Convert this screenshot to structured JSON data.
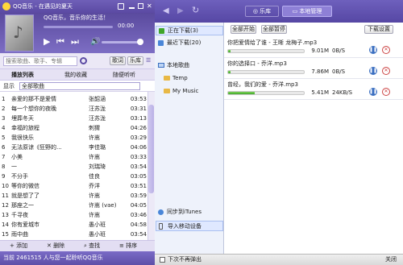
{
  "app": {
    "title": "QQ音乐 - 在遇见的夏天",
    "now_playing": "QQ音乐，音乐你的生活！",
    "time": "00:00",
    "search_placeholder": "搜索歌曲、歌手、专辑",
    "search_btn": "搜索",
    "lyrics_btn": "歌词",
    "library_btn": "乐库"
  },
  "playlist_tabs": [
    "播放列表",
    "我的收藏",
    "随便听听"
  ],
  "list_header": {
    "label": "显示",
    "value": "全部歌曲"
  },
  "songs": [
    {
      "n": "1",
      "title": "亲爱的那不是爱情",
      "artist": "张韶涵",
      "time": "03:53"
    },
    {
      "n": "2",
      "title": "每一个想你的夜晚",
      "artist": "汪苏泷",
      "time": "03:31"
    },
    {
      "n": "3",
      "title": "埋葬冬天",
      "artist": "汪苏泷",
      "time": "03:13"
    },
    {
      "n": "4",
      "title": "幸福的旅程",
      "artist": "刺猬",
      "time": "04:26"
    },
    {
      "n": "5",
      "title": "我很快乐",
      "artist": "许嵩",
      "time": "03:29"
    },
    {
      "n": "6",
      "title": "无法原谅《狂野的...",
      "artist": "李佳璐",
      "time": "04:06"
    },
    {
      "n": "7",
      "title": "小美",
      "artist": "许嵩",
      "time": "03:33"
    },
    {
      "n": "8",
      "title": "一",
      "artist": "刘瑞琦",
      "time": "03:54"
    },
    {
      "n": "9",
      "title": "不分手",
      "artist": "佳良",
      "time": "03:05"
    },
    {
      "n": "10",
      "title": "等你的微信",
      "artist": "乔洋",
      "time": "03:51"
    },
    {
      "n": "11",
      "title": "就是想了了",
      "artist": "许嵩",
      "time": "03:59"
    },
    {
      "n": "12",
      "title": "那座之一",
      "artist": "许嵩 (vae)",
      "time": "04:05"
    },
    {
      "n": "13",
      "title": "千寻夜",
      "artist": "许嵩",
      "time": "03:46"
    },
    {
      "n": "14",
      "title": "你有爱城市",
      "artist": "愚小班",
      "time": "04:58"
    },
    {
      "n": "15",
      "title": "雨中曲",
      "artist": "愚小班",
      "time": "03:54"
    }
  ],
  "bottom_actions": [
    "添加",
    "删除",
    "查找",
    "排序"
  ],
  "status_text": "当前 2461515 人与您一起聆听QQ音乐",
  "nav_tabs": [
    "乐库",
    "本地管理"
  ],
  "tree": {
    "downloading": "正在下载(3)",
    "recent": "最近下载(20)",
    "local": "本地歌曲",
    "folders": [
      "Temp",
      "My Music"
    ],
    "sync": "同步到iTunes",
    "import": "导入移动设备"
  },
  "dl_toolbar": {
    "start_all": "全部开始",
    "pause_all": "全部暂停",
    "settings": "下载设置"
  },
  "downloads": [
    {
      "name": "你把爱情给了谁 - 王晰 龙梅子.mp3",
      "size": "9.01M",
      "speed": "0B/S",
      "progress": 0.02
    },
    {
      "name": "你的选择口 - 乔洋.mp3",
      "size": "7.86M",
      "speed": "0B/S",
      "progress": 0.02
    },
    {
      "name": "曾经，我们的爱 - 乔洋.mp3",
      "size": "5.41M",
      "speed": "24KB/S",
      "progress": 0.35
    }
  ],
  "right_status": {
    "checkbox_label": "下次不再弹出",
    "close": "关闭"
  },
  "colors": {
    "accent": "#5b4aa3",
    "progress": "#3fa52a",
    "selected": "#dfe8ff"
  }
}
